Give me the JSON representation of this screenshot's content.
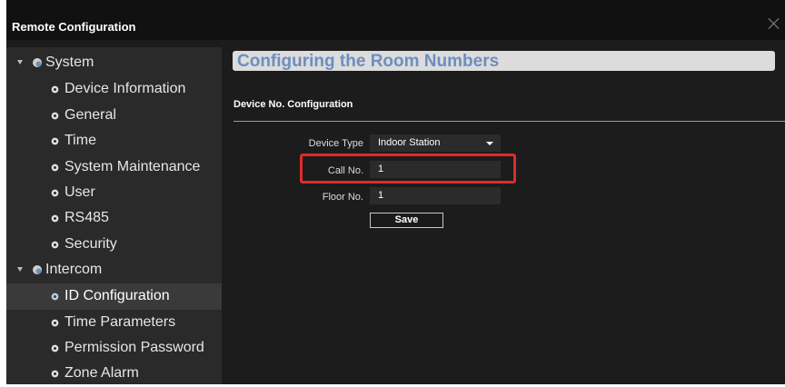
{
  "window": {
    "title": "Remote Configuration"
  },
  "sidebar": {
    "groups": [
      {
        "label": "System",
        "items": [
          {
            "label": "Device Information"
          },
          {
            "label": "General"
          },
          {
            "label": "Time"
          },
          {
            "label": "System Maintenance"
          },
          {
            "label": "User"
          },
          {
            "label": "RS485"
          },
          {
            "label": "Security"
          }
        ]
      },
      {
        "label": "Intercom",
        "items": [
          {
            "label": "ID Configuration",
            "selected": true
          },
          {
            "label": "Time Parameters"
          },
          {
            "label": "Permission Password"
          },
          {
            "label": "Zone Alarm"
          }
        ]
      }
    ]
  },
  "main": {
    "heading": "Configuring the Room Numbers",
    "section_title": "Device No. Configuration",
    "fields": {
      "device_type": {
        "label": "Device Type",
        "value": "Indoor Station"
      },
      "call_no": {
        "label": "Call No.",
        "value": "1"
      },
      "floor_no": {
        "label": "Floor No.",
        "value": "1"
      }
    },
    "save_label": "Save"
  },
  "colors": {
    "highlight": "#e02a2a",
    "heading_text": "#6e8ebf"
  }
}
